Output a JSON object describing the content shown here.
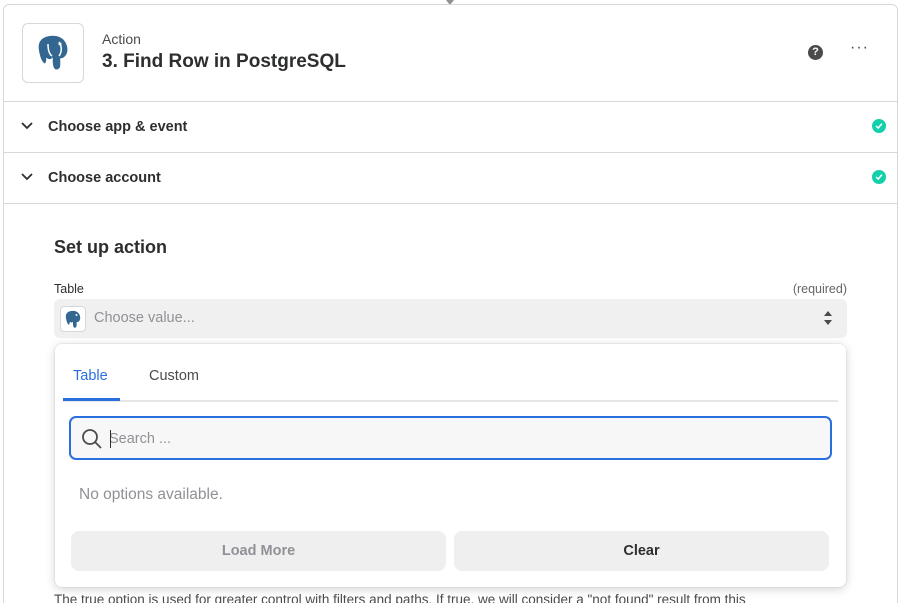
{
  "step": {
    "kind": "Action",
    "title": "3. Find Row in PostgreSQL",
    "help_glyph": "?",
    "more_glyph": "···",
    "app_icon": "postgresql-elephant-icon"
  },
  "sections": [
    {
      "label": "Choose app & event",
      "status": "complete"
    },
    {
      "label": "Choose account",
      "status": "complete"
    }
  ],
  "setup": {
    "title": "Set up action",
    "field": {
      "label": "Table",
      "required_text": "(required)",
      "placeholder": "Choose value..."
    },
    "help_text": "The true option is used for greater control with filters and paths. If true, we will consider a \"not found\" result from this"
  },
  "dropdown": {
    "tabs": [
      {
        "label": "Table",
        "active": true
      },
      {
        "label": "Custom",
        "active": false
      }
    ],
    "search_placeholder": "Search ...",
    "empty_message": "No options available.",
    "load_more_label": "Load More",
    "clear_label": "Clear"
  },
  "colors": {
    "accent": "#2a6ee0",
    "success": "#13d0ab",
    "border": "#d5d7d9"
  }
}
